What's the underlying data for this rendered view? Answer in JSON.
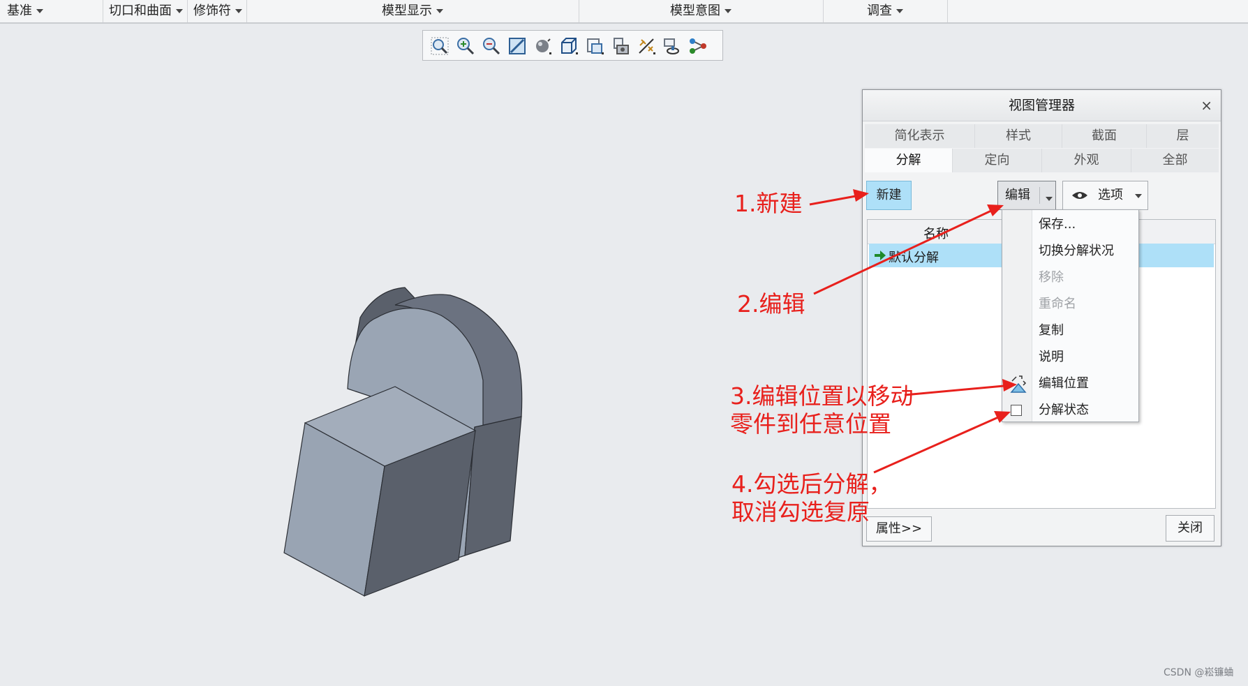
{
  "ribbon": {
    "groups": [
      "基准",
      "切口和曲面",
      "修饰符",
      "模型显示",
      "模型意图",
      "调查"
    ]
  },
  "graphics_toolbar": {
    "icons": [
      "refit-icon",
      "zoom-in-icon",
      "zoom-out-icon",
      "repaint-icon",
      "display-style-icon",
      "saved-orientations-icon",
      "view-manager-icon",
      "perspective-icon",
      "datum-display-icon",
      "spin-center-icon",
      "annotation-display-icon"
    ]
  },
  "dialog": {
    "title": "视图管理器",
    "close_glyph": "×",
    "tabs_row1": [
      "简化表示",
      "样式",
      "截面",
      "层"
    ],
    "tabs_row2": [
      "分解",
      "定向",
      "外观",
      "全部"
    ],
    "active_tab": "分解",
    "new_button": "新建",
    "edit_button": "编辑",
    "options_button": "选项",
    "list_header": "名称",
    "list_items": [
      "默认分解"
    ],
    "properties_button": "属性>>",
    "close_button": "关闭"
  },
  "edit_menu": {
    "items": [
      {
        "label": "保存...",
        "enabled": true
      },
      {
        "label": "切换分解状况",
        "enabled": true
      },
      {
        "label": "移除",
        "enabled": false
      },
      {
        "label": "重命名",
        "enabled": false
      },
      {
        "label": "复制",
        "enabled": true
      },
      {
        "label": "说明",
        "enabled": true
      },
      {
        "label": "编辑位置",
        "enabled": true
      },
      {
        "label": "分解状态",
        "enabled": true,
        "checked": false
      }
    ]
  },
  "annotations": {
    "a1": "1.新建",
    "a2": "2.编辑",
    "a3_line1": "3.编辑位置以移动",
    "a3_line2": "零件到任意位置",
    "a4_line1": "4.勾选后分解，",
    "a4_line2": "取消勾选复原"
  },
  "colors": {
    "annotation": "#e8201c",
    "selection": "#aee0f8",
    "model_light": "#99a4b3",
    "model_dark": "#5a606b"
  },
  "watermark": "CSDN @崧镰蛐"
}
